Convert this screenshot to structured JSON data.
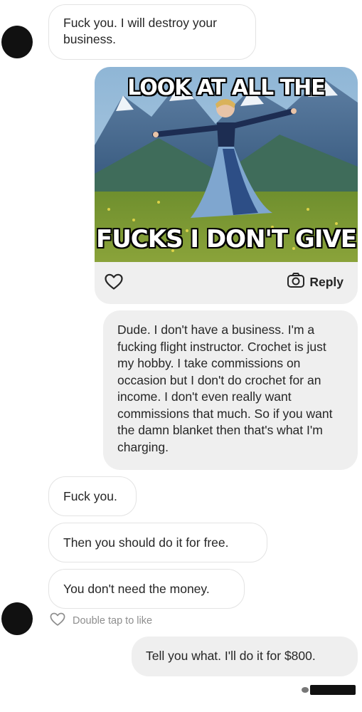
{
  "conversation": {
    "messages": [
      {
        "from": "them",
        "text": "Fuck you. I will destroy your business."
      },
      {
        "from": "me",
        "kind": "meme",
        "caption_top": "LOOK AT ALL THE",
        "caption_bottom": "FUCKS I DON'T GIVE",
        "reply_label": "Reply"
      },
      {
        "from": "me",
        "text": "Dude. I don't have a business. I'm a fucking flight instructor. Crochet is just my hobby. I take commissions on occasion but I don't do crochet for an income. I don't even really want commissions that much. So if you want the damn blanket then that's what I'm charging."
      },
      {
        "from": "them",
        "text": "Fuck you."
      },
      {
        "from": "them",
        "text": "Then you should do it for free."
      },
      {
        "from": "them",
        "text": "You don't need the money."
      },
      {
        "from": "me",
        "text": "Tell you what. I'll do it for $800."
      }
    ],
    "like_hint": "Double tap to like"
  },
  "icons": {
    "heart": "heart-outline-icon",
    "camera": "camera-icon"
  },
  "colors": {
    "incoming_bubble": "#ffffff",
    "outgoing_bubble": "#efefef",
    "text": "#262626",
    "hint": "#8e8e8e"
  }
}
